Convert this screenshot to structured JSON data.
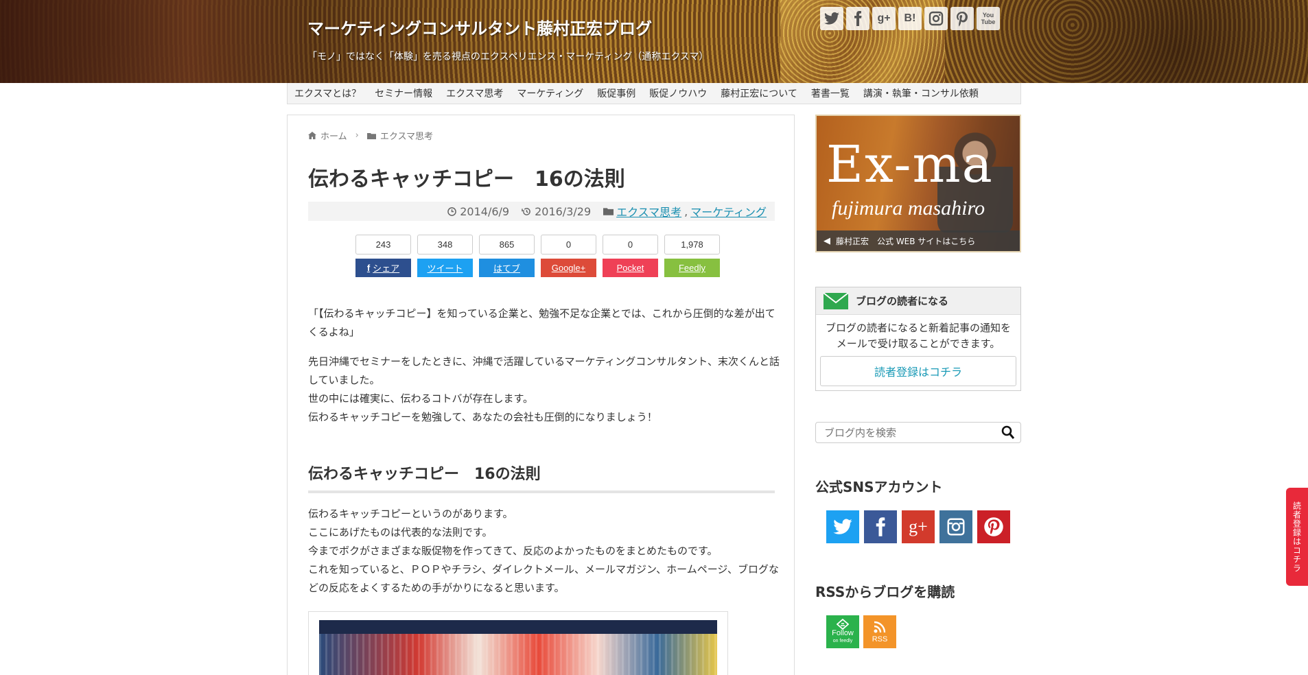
{
  "site": {
    "title": "マーケティングコンサルタント藤村正宏ブログ",
    "tagline": "「モノ」ではなく「体験」を売る視点のエクスペリエンス・マーケティング（通称エクスマ）"
  },
  "header_sns": [
    {
      "name": "twitter",
      "icon": "twitter-icon"
    },
    {
      "name": "facebook",
      "icon": "facebook-icon"
    },
    {
      "name": "googleplus",
      "icon": "googleplus-icon",
      "glyph": "g+"
    },
    {
      "name": "hatena",
      "icon": "hatena-bookmark-icon",
      "glyph": "B!"
    },
    {
      "name": "instagram",
      "icon": "instagram-icon"
    },
    {
      "name": "pinterest",
      "icon": "pinterest-icon"
    },
    {
      "name": "youtube",
      "icon": "youtube-icon",
      "glyph": "You Tube"
    }
  ],
  "nav": {
    "items": [
      "エクスマとは？",
      "セミナー情報",
      "エクスマ思考",
      "マーケティング",
      "販促事例",
      "販促ノウハウ",
      "藤村正宏について",
      "著書一覧",
      "講演・執筆・コンサル依頼"
    ]
  },
  "breadcrumb": {
    "home": "ホーム",
    "category": "エクスマ思考"
  },
  "post": {
    "title": "伝わるキャッチコピー　16の法則",
    "published": "2014/6/9",
    "updated": "2016/3/29",
    "categories": [
      "エクスマ思考",
      "マーケティング"
    ],
    "category_sep": ",",
    "intro_quote": "「【伝わるキャッチコピー】を知っている企業と、勉強不足な企業とでは、これから圧倒的な差が出てくるよね」",
    "para1": [
      "先日沖縄でセミナーをしたときに、沖縄で活躍しているマーケティングコンサルタント、末次くんと話していました。",
      "世の中には確実に、伝わるコトバが存在します。",
      "伝わるキャッチコピーを勉強して、あなたの会社も圧倒的になりましょう！"
    ],
    "heading2": "伝わるキャッチコピー　16の法則",
    "para2": [
      "伝わるキャッチコピーというのがあります。",
      "ここにあげたものは代表的な法則です。",
      "今までボクがさまざまな販促物を作ってきて、反応のよかったものをまとめたものです。",
      "これを知っていると、ＰＯＰやチラシ、ダイレクトメール、メールマガジン、ホームページ、ブログなどの反応をよくするための手がかりになると思います。"
    ]
  },
  "share": [
    {
      "count": "243",
      "label": "シェア",
      "color": "#2d4f8e",
      "icon": "facebook-icon"
    },
    {
      "count": "348",
      "label": "ツイート",
      "color": "#1da1f2"
    },
    {
      "count": "865",
      "label": "はてブ",
      "color": "#1f8fe0"
    },
    {
      "count": "0",
      "label": "Google+",
      "color": "#dd4b39"
    },
    {
      "count": "0",
      "label": "Pocket",
      "color": "#ef4056"
    },
    {
      "count": "1,978",
      "label": "Feedly",
      "color": "#87c040"
    }
  ],
  "sidebar": {
    "banner": {
      "big": "Ex-ma",
      "small": "fujimura masahiro",
      "link": "藤村正宏　公式 WEB サイトはこちら"
    },
    "reader": {
      "title": "ブログの読者になる",
      "desc_line1": "ブログの読者になると新着記事の通知を",
      "desc_line2": "メールで受け取ることができます。",
      "button": "読者登録はコチラ"
    },
    "search": {
      "placeholder": "ブログ内を検索"
    },
    "sns_heading": "公式SNSアカウント",
    "sns": [
      {
        "name": "twitter",
        "color": "#1da1f2"
      },
      {
        "name": "facebook",
        "color": "#3b5998"
      },
      {
        "name": "googleplus",
        "color": "#d23a2c",
        "glyph": "g+"
      },
      {
        "name": "instagram",
        "color": "#3f729b"
      },
      {
        "name": "pinterest",
        "color": "#cb2027"
      }
    ],
    "rss_heading": "RSSからブログを購読",
    "feedly": {
      "line1": "Follow",
      "line2": "on feedly",
      "color": "#2bb24c"
    },
    "rss": {
      "label": "RSS",
      "color": "#f39429"
    }
  },
  "side_tab": "読者登録はコチラ"
}
